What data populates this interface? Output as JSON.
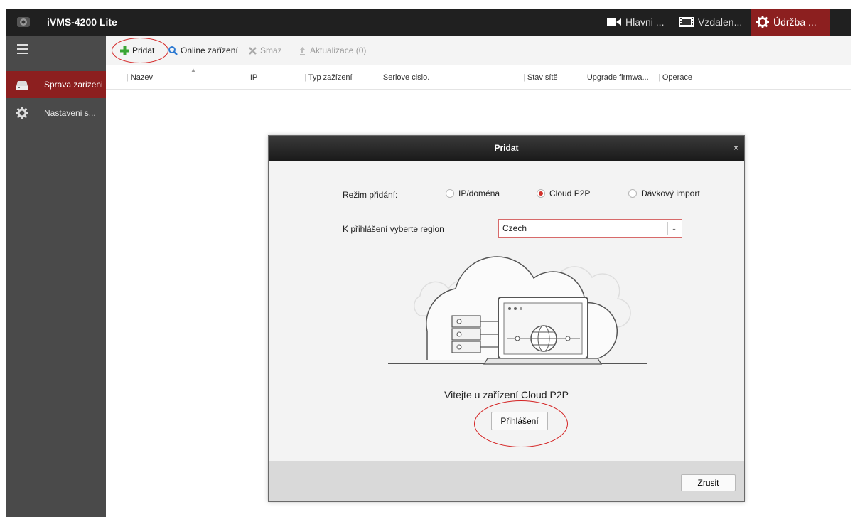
{
  "app": {
    "title": "iVMS-4200 Lite"
  },
  "top_tabs": [
    {
      "label": "Hlavni ...",
      "icon": "video-camera-icon",
      "active": false
    },
    {
      "label": "Vzdalen...",
      "icon": "film-icon",
      "active": false
    },
    {
      "label": "Údržba ...",
      "icon": "gear-icon",
      "active": true
    }
  ],
  "sidebar": {
    "items": [
      {
        "label": "Sprava zarizeni",
        "icon": "device-drive-icon",
        "active": true
      },
      {
        "label": "Nastaveni s...",
        "icon": "gear-icon",
        "active": false
      }
    ]
  },
  "toolbar": {
    "add_label": "Pridat",
    "online_label": "Online zařízení",
    "delete_label": "Smaz",
    "update_label": "Aktualizace (0)"
  },
  "table": {
    "columns": [
      "Nazev",
      "IP",
      "Typ zažízení",
      "Seriove cislo.",
      "Stav sítě",
      "Upgrade firmwa...",
      "Operace"
    ]
  },
  "dialog": {
    "title": "Pridat",
    "close": "×",
    "mode_label": "Režim přidání:",
    "modes": [
      {
        "label": "IP/doména",
        "checked": false
      },
      {
        "label": "Cloud P2P",
        "checked": true
      },
      {
        "label": "Dávkový import",
        "checked": false
      }
    ],
    "region_label": "K přihlášení vyberte region",
    "region_value": "Czech",
    "welcome_text": "Vitejte u zařízení Cloud P2P",
    "login_button": "Přihlášení",
    "cancel_button": "Zrusit"
  },
  "colors": {
    "accent": "#8c1f1f",
    "titlebar": "#202020",
    "sidebar": "#4a4a4a",
    "radio_selected": "#d0302a",
    "annotation": "#d42222"
  }
}
